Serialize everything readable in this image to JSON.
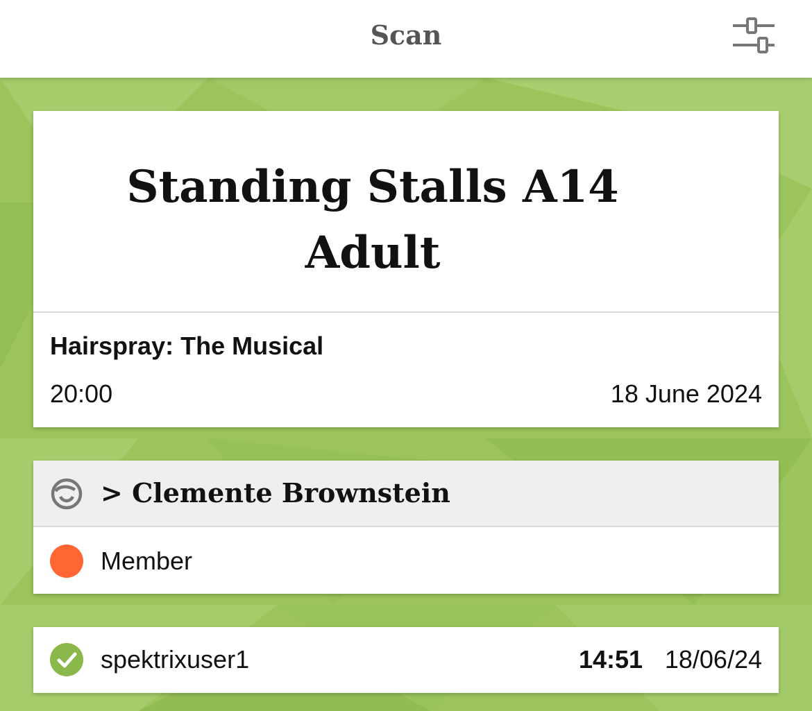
{
  "header": {
    "title": "Scan",
    "settings_icon": "sliders-icon"
  },
  "ticket": {
    "seat": "Standing Stalls A14",
    "type": "Adult",
    "event_name": "Hairspray: The Musical",
    "time": "20:00",
    "date": "18 June 2024"
  },
  "customer": {
    "icon": "customer-face-icon",
    "name": "> Clemente Brownstein",
    "tag_label": "Member",
    "tag_color": "#ff6633"
  },
  "scan_log": {
    "status_icon": "check-circle-icon",
    "status_color": "#8ab84a",
    "user": "spektrixuser1",
    "time": "14:51",
    "date": "18/06/24"
  },
  "colors": {
    "background": "#9cc45c",
    "header_text": "#555555"
  }
}
